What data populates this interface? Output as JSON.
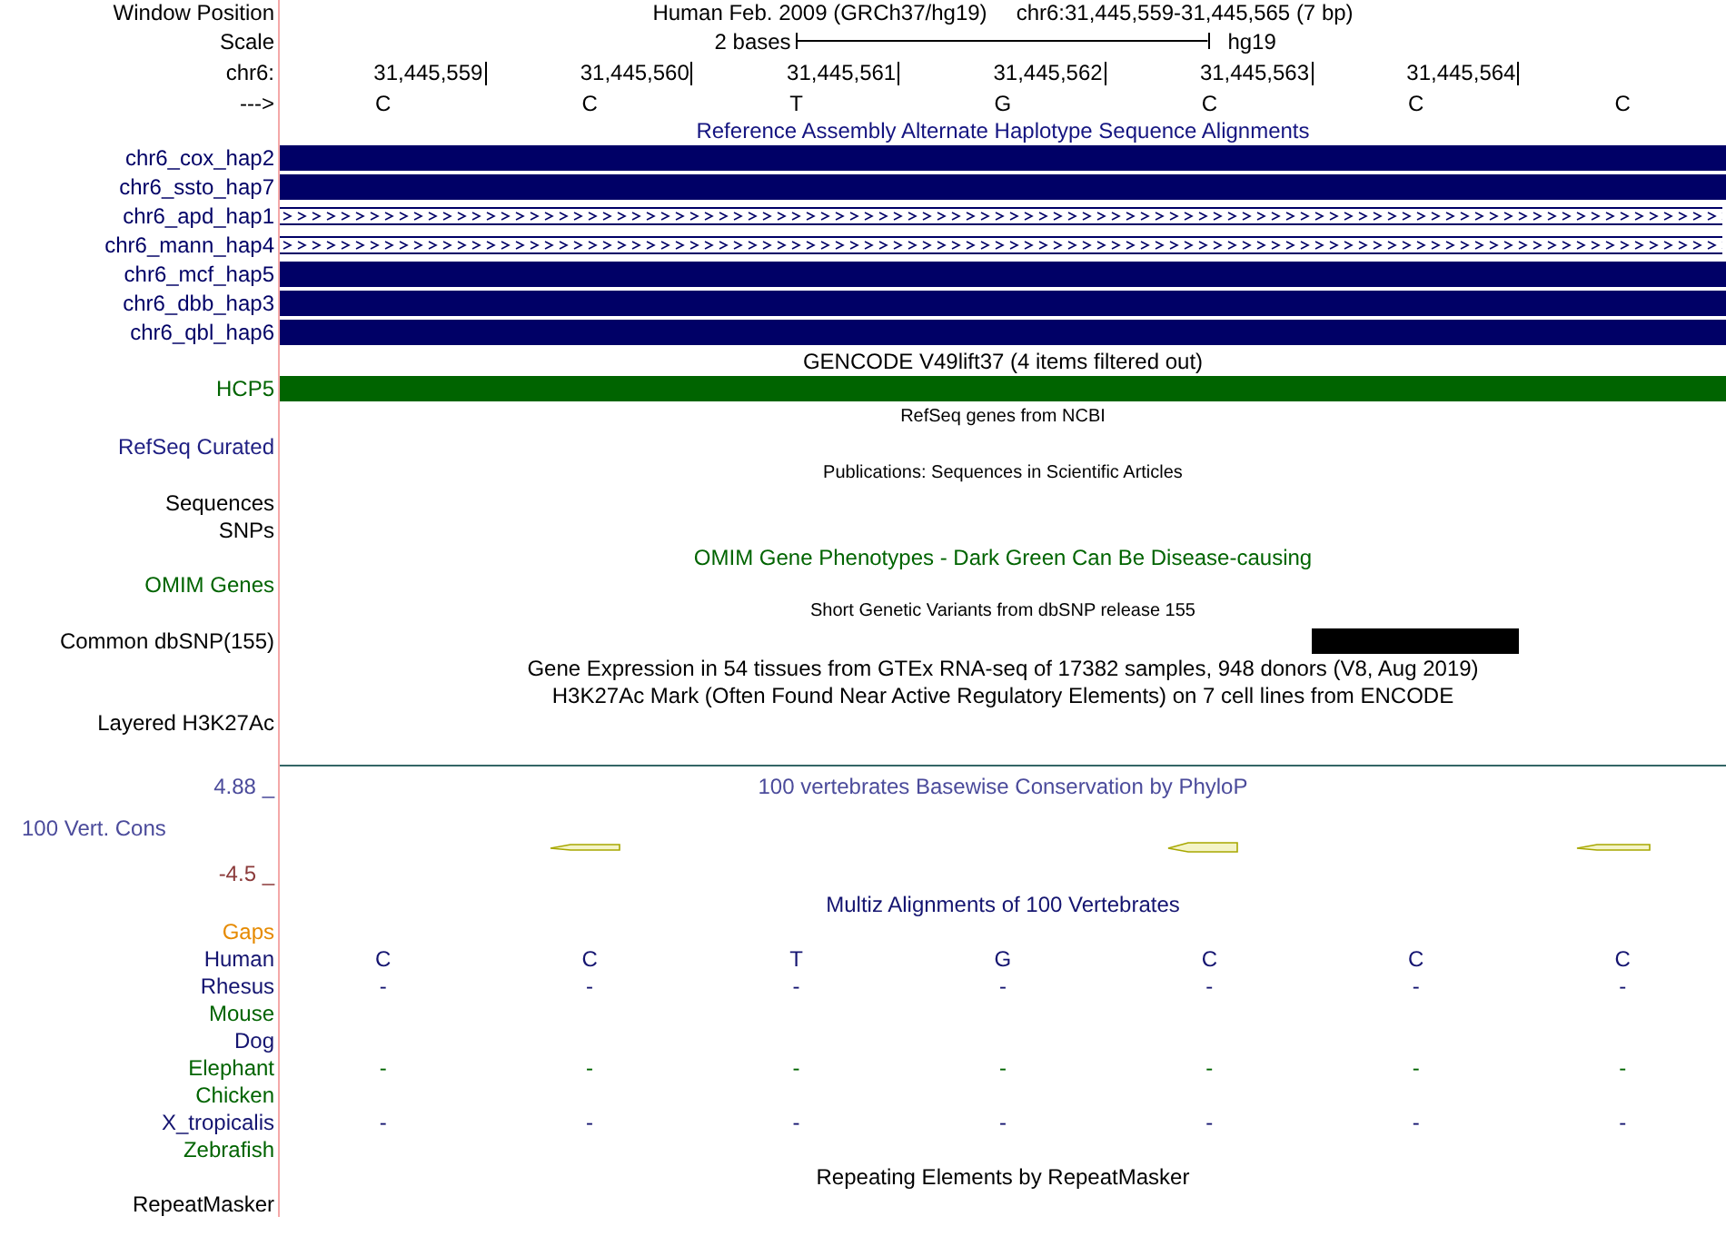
{
  "rows": [
    {
      "kind": "position",
      "label": "Window Position",
      "color": "#000000",
      "assembly": "Human Feb. 2009 (GRCh37/hg19)",
      "range": "chr6:31,445,559-31,445,565 (7 bp)"
    },
    {
      "kind": "scale",
      "label": "Scale",
      "color": "#000000",
      "span": "2 bases",
      "db": "hg19"
    },
    {
      "kind": "coords",
      "label": "chr6:",
      "color": "#000000",
      "cells": [
        "31,445,559",
        "31,445,560",
        "31,445,561",
        "31,445,562",
        "31,445,563",
        "31,445,564"
      ]
    },
    {
      "kind": "bases",
      "label": "--->",
      "color": "#000000",
      "cells": [
        "C",
        "C",
        "T",
        "G",
        "C",
        "C",
        "C"
      ]
    },
    {
      "kind": "title",
      "text": "Reference Assembly Alternate Haplotype Sequence Alignments",
      "color": "#141480"
    },
    {
      "kind": "bar",
      "label": "chr6_cox_hap2",
      "color": "#000066"
    },
    {
      "kind": "bar",
      "label": "chr6_ssto_hap7",
      "color": "#000066"
    },
    {
      "kind": "chevron",
      "label": "chr6_apd_hap1",
      "color": "#000066"
    },
    {
      "kind": "chevron",
      "label": "chr6_mann_hap4",
      "color": "#000066"
    },
    {
      "kind": "bar",
      "label": "chr6_mcf_hap5",
      "color": "#000066"
    },
    {
      "kind": "bar",
      "label": "chr6_dbb_hap3",
      "color": "#000066"
    },
    {
      "kind": "bar",
      "label": "chr6_qbl_hap6",
      "color": "#000066"
    },
    {
      "kind": "title",
      "text": "GENCODE V49lift37 (4 items filtered out)",
      "color": "#000000"
    },
    {
      "kind": "bar",
      "label": "HCP5",
      "color": "#006400"
    },
    {
      "kind": "small_title",
      "text": "RefSeq genes from NCBI",
      "color": "#000000"
    },
    {
      "kind": "label",
      "label": "RefSeq Curated",
      "color": "#1e1e82"
    },
    {
      "kind": "small_title",
      "text": "Publications: Sequences in Scientific Articles",
      "color": "#000000"
    },
    {
      "kind": "label",
      "label": "Sequences",
      "color": "#000000"
    },
    {
      "kind": "label",
      "label": "SNPs",
      "color": "#000000"
    },
    {
      "kind": "title",
      "text": "OMIM Gene Phenotypes - Dark Green Can Be Disease-causing",
      "color": "#006400"
    },
    {
      "kind": "label",
      "label": "OMIM Genes",
      "color": "#006400"
    },
    {
      "kind": "small_title",
      "text": "Short Genetic Variants from dbSNP release 155",
      "color": "#000000"
    },
    {
      "kind": "feature",
      "label": "Common dbSNP(155)",
      "color": "#000000"
    },
    {
      "kind": "title",
      "text": "Gene Expression in 54 tissues from GTEx RNA-seq of 17382 samples, 948 donors (V8, Aug 2019)",
      "color": "#000000"
    },
    {
      "kind": "title",
      "text": "H3K27Ac Mark (Often Found Near Active Regulatory Elements) on 7 cell lines from ENCODE",
      "color": "#000000"
    },
    {
      "kind": "label",
      "label": "Layered H3K27Ac",
      "color": "#000000"
    },
    {
      "kind": "divider"
    },
    {
      "kind": "conservation",
      "title": "100 vertebrates Basewise Conservation by PhyloP",
      "max": "4.88 _",
      "label": "100 Vert. Cons",
      "min": "-4.5 _",
      "color": "#4b4b9b"
    },
    {
      "kind": "title",
      "text": "Multiz Alignments of 100 Vertebrates",
      "color": "#141470"
    },
    {
      "kind": "species",
      "label": "Gaps",
      "color": "#e68a00"
    },
    {
      "kind": "species",
      "label": "Human",
      "color": "#141470",
      "cells": [
        "C",
        "C",
        "T",
        "G",
        "C",
        "C",
        "C"
      ]
    },
    {
      "kind": "species",
      "label": "Rhesus",
      "color": "#141470",
      "cells": [
        "-",
        "-",
        "-",
        "-",
        "-",
        "-",
        "-"
      ]
    },
    {
      "kind": "species",
      "label": "Mouse",
      "color": "#006400"
    },
    {
      "kind": "species",
      "label": "Dog",
      "color": "#141470"
    },
    {
      "kind": "species",
      "label": "Elephant",
      "color": "#006400",
      "cells": [
        "-",
        "-",
        "-",
        "-",
        "-",
        "-",
        "-"
      ]
    },
    {
      "kind": "species",
      "label": "Chicken",
      "color": "#006400"
    },
    {
      "kind": "species",
      "label": "X_tropicalis",
      "color": "#141470",
      "cells": [
        "-",
        "-",
        "-",
        "-",
        "-",
        "-",
        "-"
      ]
    },
    {
      "kind": "species",
      "label": "Zebrafish",
      "color": "#006400"
    },
    {
      "kind": "title",
      "text": "Repeating Elements by RepeatMasker",
      "color": "#000000"
    },
    {
      "kind": "label",
      "label": "RepeatMasker",
      "color": "#000000"
    }
  ]
}
